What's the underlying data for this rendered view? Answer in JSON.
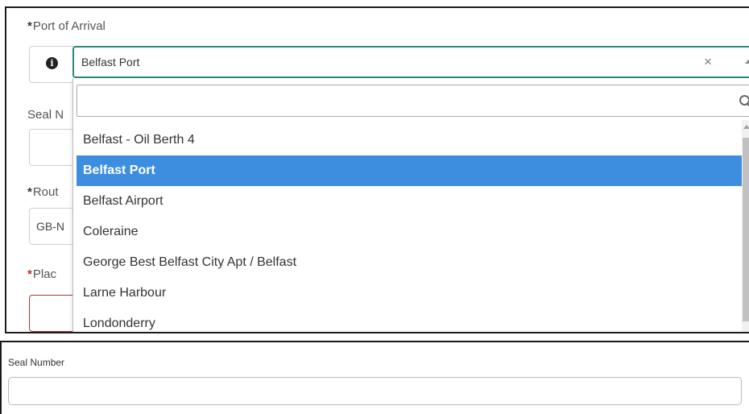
{
  "port_of_arrival": {
    "required_mark": "*",
    "label": "Port of Arrival",
    "selected_value": "Belfast Port",
    "clear_symbol": "×",
    "info_icon_glyph": "i"
  },
  "background_fields": {
    "seal_label_partial": "Seal N",
    "route_required_mark": "*",
    "route_label_partial": "Rout",
    "route_value_partial": "GB-N",
    "place_required_mark": "*",
    "place_label_partial": "Plac"
  },
  "dropdown": {
    "search_placeholder": "",
    "options": [
      {
        "label": "Belfast - Oil Berth 4",
        "selected": false
      },
      {
        "label": "Belfast Port",
        "selected": true
      },
      {
        "label": "Belfast Airport",
        "selected": false
      },
      {
        "label": "Coleraine",
        "selected": false
      },
      {
        "label": "George Best Belfast City Apt / Belfast",
        "selected": false
      },
      {
        "label": "Larne Harbour",
        "selected": false
      },
      {
        "label": "Londonderry",
        "selected": false
      }
    ]
  },
  "seal_number": {
    "label": "Seal Number",
    "value": ""
  },
  "colors": {
    "focus_border": "#2b8a78",
    "selected_option_bg": "#3e8ee0",
    "required_error": "#c62828"
  },
  "icons": [
    "info-icon",
    "clear-icon",
    "caret-up-icon",
    "search-icon"
  ]
}
